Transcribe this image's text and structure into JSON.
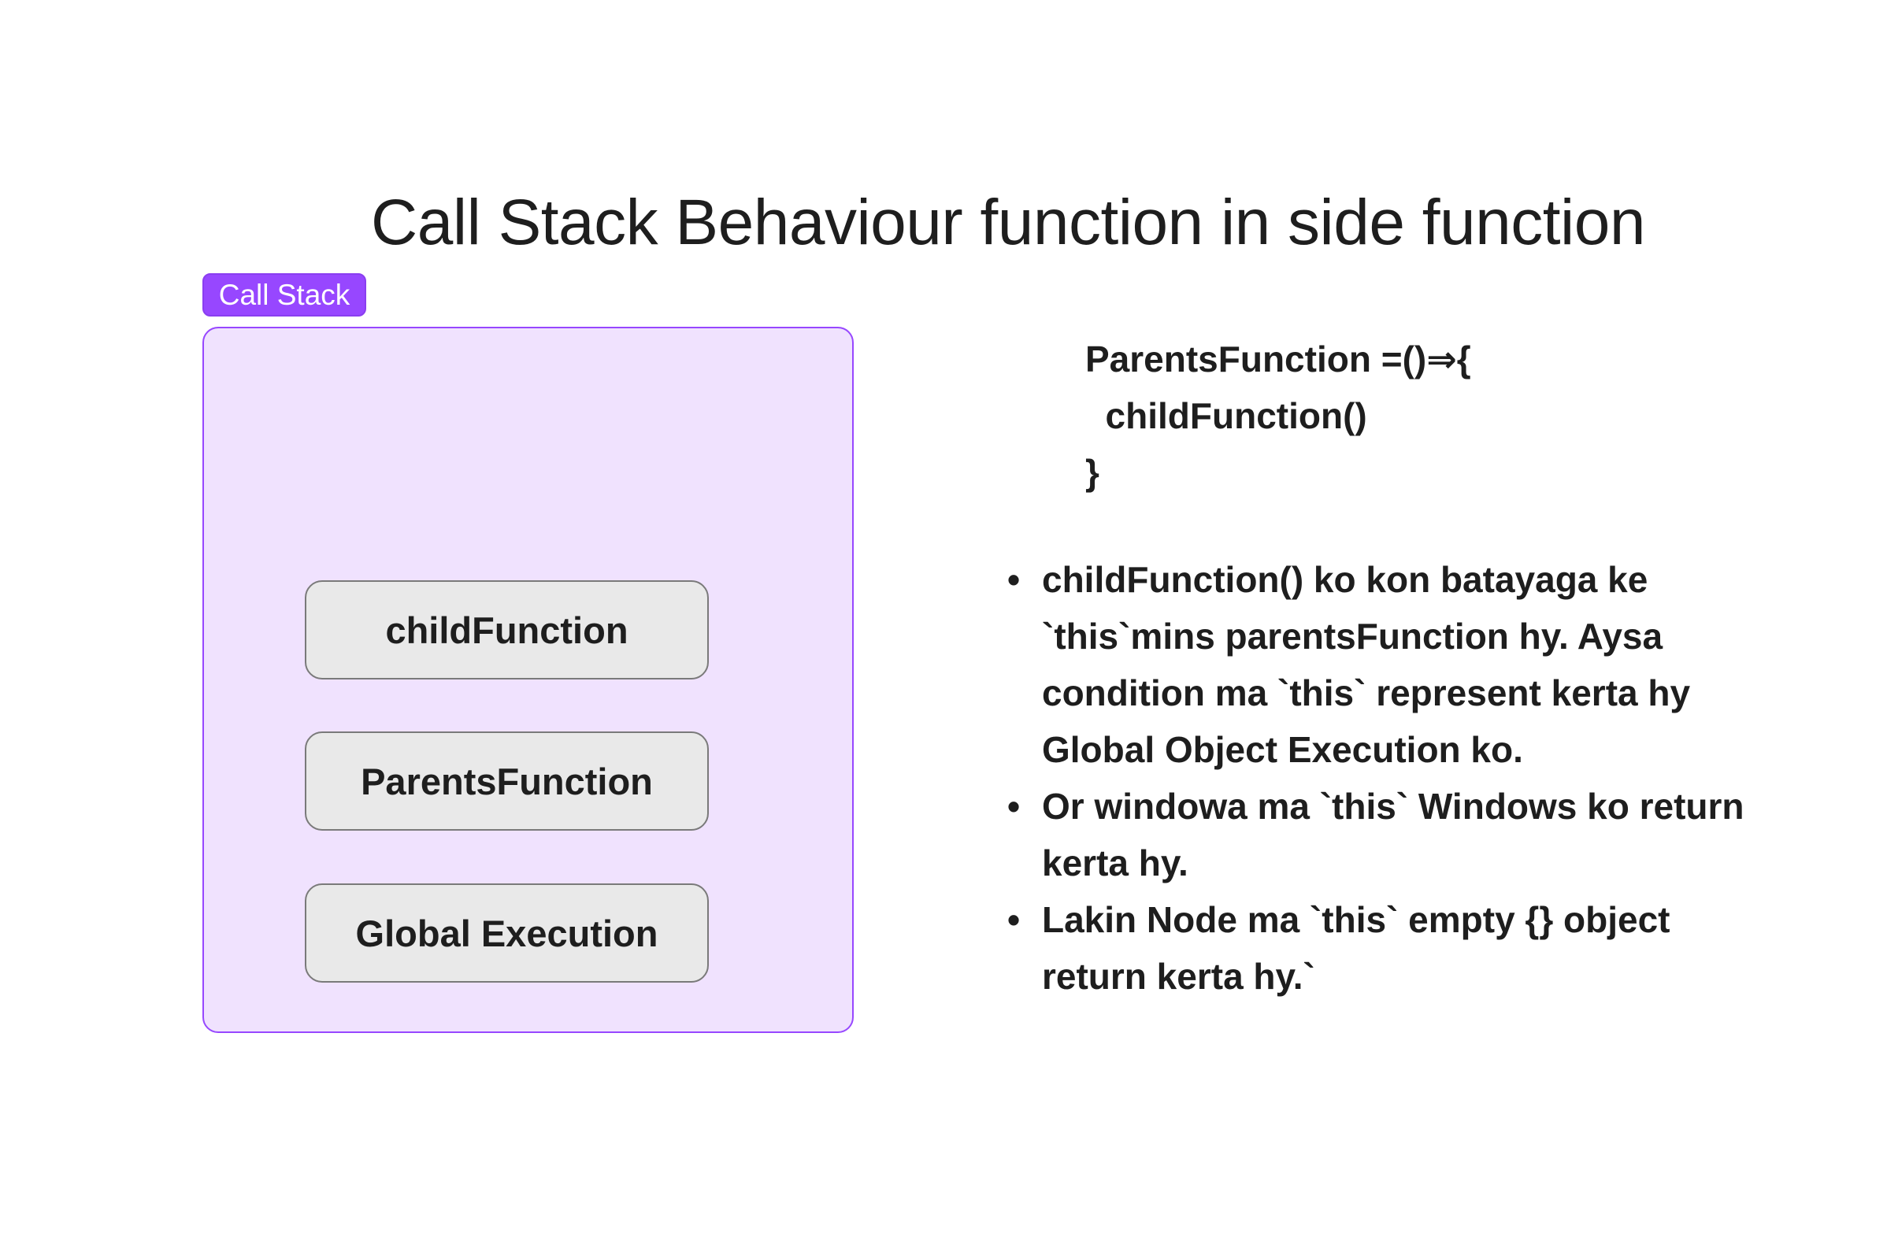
{
  "title": "Call Stack Behaviour function in side function",
  "section": {
    "label": "Call Stack",
    "frames": [
      "childFunction",
      "ParentsFunction",
      "Global Execution"
    ]
  },
  "code": {
    "lines": [
      "ParentsFunction =()⇒{",
      "  childFunction()",
      "}"
    ]
  },
  "notes": [
    "childFunction() ko kon batayaga ke `this`mins parentsFunction hy. Aysa condition ma `this` represent kerta hy Global Object Execution ko.",
    "Or windowa ma `this`  Windows ko return kerta hy.",
    "Lakin Node ma `this` empty {} object return kerta hy.`"
  ],
  "colors": {
    "section_fill": "#f0e2fe",
    "section_stroke": "#9747ff",
    "frame_fill": "#e9e9e9",
    "text": "#1e1e1e"
  }
}
